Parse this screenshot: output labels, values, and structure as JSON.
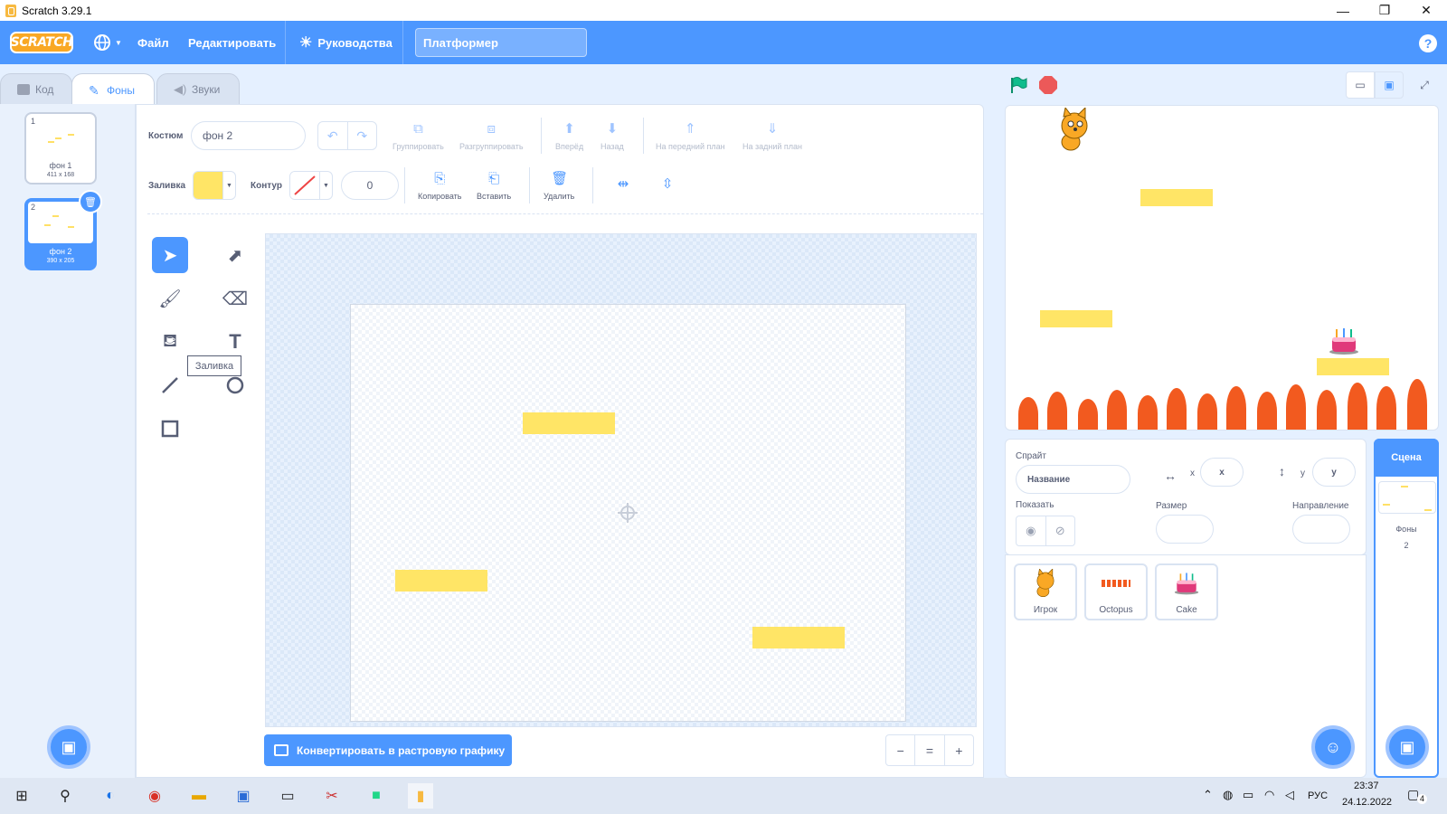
{
  "window": {
    "title": "Scratch 3.29.1",
    "minimize": "—",
    "maximize": "❐",
    "close": "✕"
  },
  "menubar": {
    "logo": "SCRATCH",
    "file": "Файл",
    "edit": "Редактировать",
    "tutorials": "Руководства",
    "project_title": "Платформер",
    "help": "?"
  },
  "tabs": [
    {
      "label": "Код"
    },
    {
      "label": "Фоны"
    },
    {
      "label": "Звуки"
    }
  ],
  "costumes": [
    {
      "num": "1",
      "name": "фон 1",
      "size": "411 x 168",
      "selected": false
    },
    {
      "num": "2",
      "name": "фон 2",
      "size": "390 x 205",
      "selected": true
    }
  ],
  "paint": {
    "costume_label": "Костюм",
    "costume_name": "фон 2",
    "group": "Группировать",
    "ungroup": "Разгруппировать",
    "forward": "Вперёд",
    "backward": "Назад",
    "front": "На передний план",
    "back": "На задний план",
    "fill_label": "Заливка",
    "fill_color": "#FFE566",
    "outline_label": "Контур",
    "outline_width": "0",
    "copy": "Копировать",
    "paste": "Вставить",
    "delete": "Удалить",
    "tooltip": "Заливка",
    "convert": "Конвертировать в растровую графику",
    "zoom_out": "−",
    "zoom_reset": "=",
    "zoom_in": "+"
  },
  "sprite_info": {
    "sprite_label": "Спрайт",
    "name_placeholder": "Название",
    "x_label": "x",
    "x_placeholder": "x",
    "y_label": "y",
    "y_placeholder": "y",
    "show_label": "Показать",
    "size_label": "Размер",
    "direction_label": "Направление"
  },
  "sprites": [
    {
      "name": "Игрок"
    },
    {
      "name": "Octopus"
    },
    {
      "name": "Cake"
    }
  ],
  "scene": {
    "label": "Сцена",
    "backdrops_label": "Фоны",
    "backdrops_count": "2"
  },
  "taskbar": {
    "lang": "РУС",
    "time": "23:37",
    "date": "24.12.2022",
    "notifications": "4"
  },
  "colors": {
    "accent": "#4C97FF",
    "platform": "#FFE566",
    "flames": "#F25A1F",
    "stop": "#EC5959",
    "flag": "#0FBD8C"
  }
}
